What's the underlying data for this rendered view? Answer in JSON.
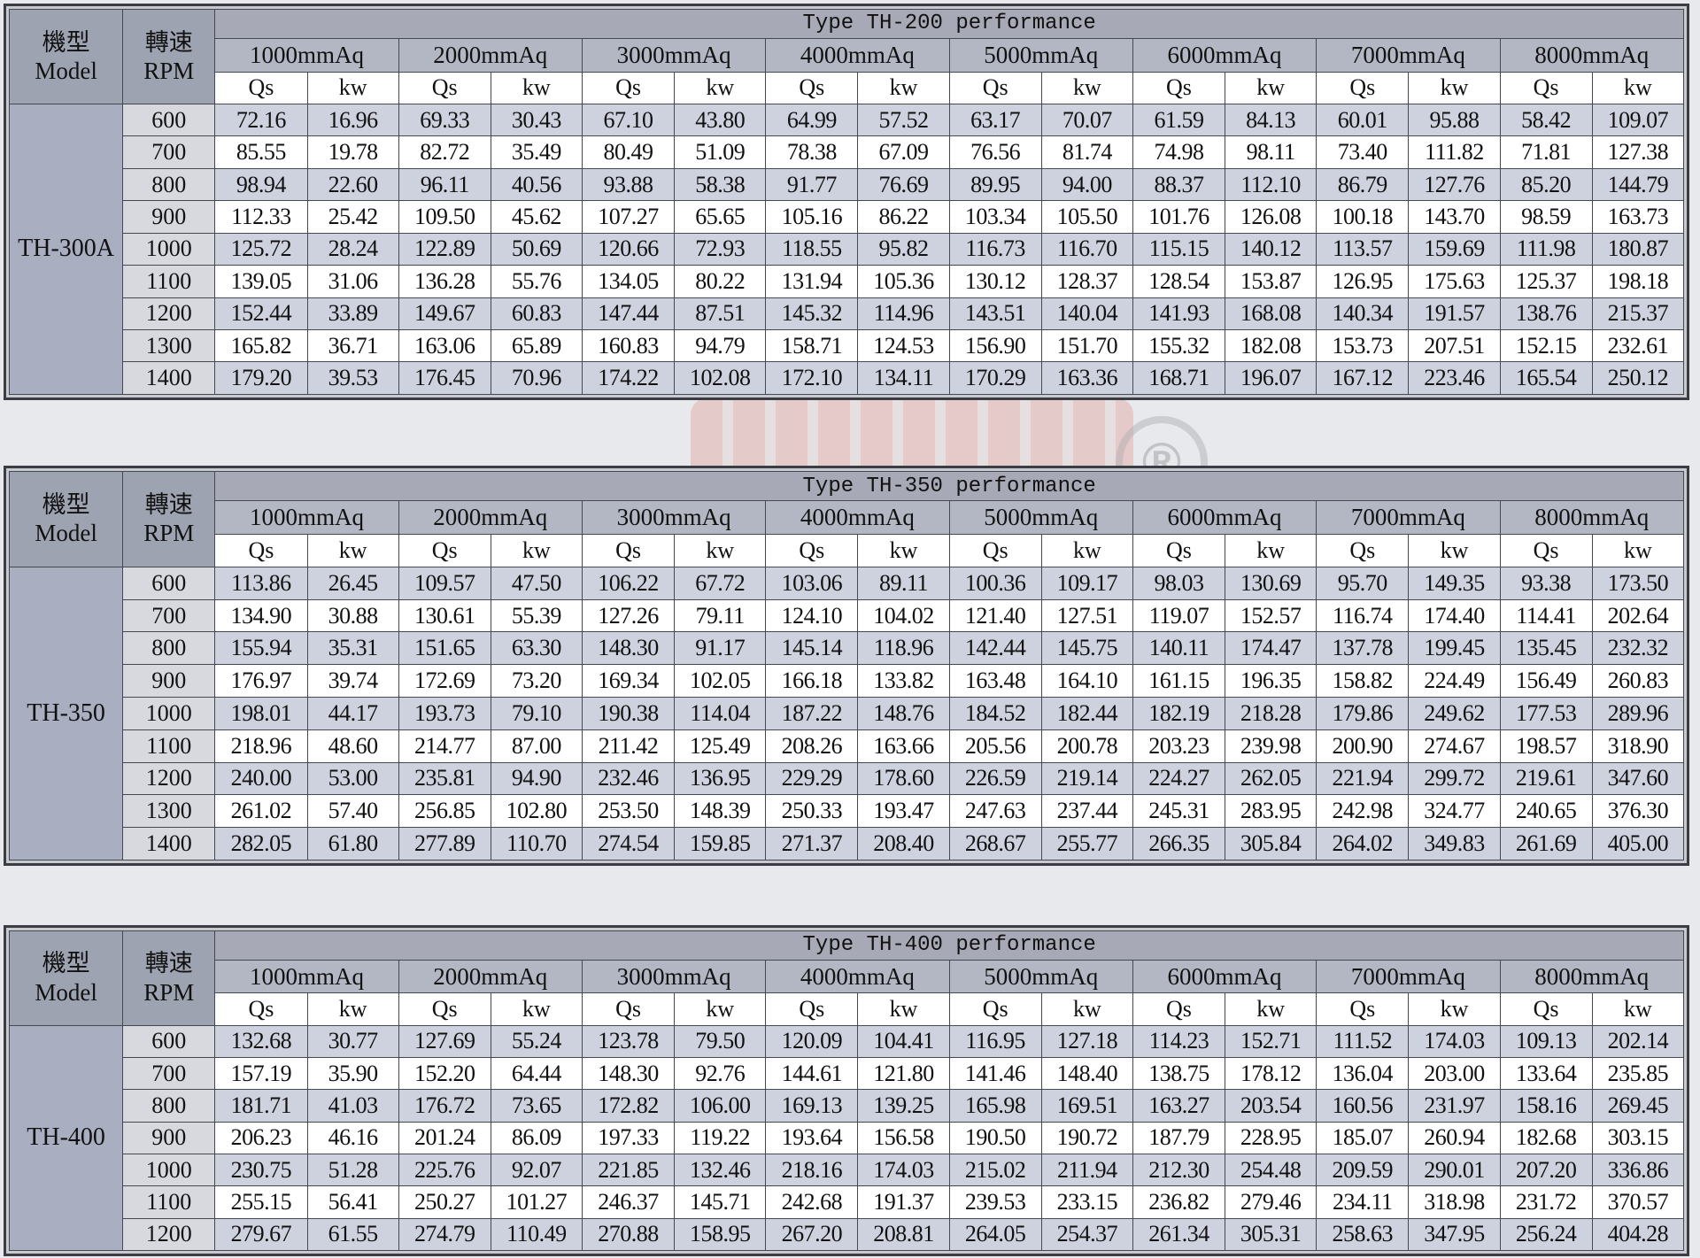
{
  "headers": {
    "model_cn": "機型",
    "model_en": "Model",
    "rpm_cn": "轉速",
    "rpm_en": "RPM",
    "qs": "Qs",
    "kw": "kw",
    "pressures": [
      "1000mmAq",
      "2000mmAq",
      "3000mmAq",
      "4000mmAq",
      "5000mmAq",
      "6000mmAq",
      "7000mmAq",
      "8000mmAq"
    ]
  },
  "watermark": {
    "registered": "®"
  },
  "colors": {
    "header": "#9ea3b2",
    "stripe": "#ced2de",
    "border": "#3a3d44"
  },
  "tables": [
    {
      "title": "Type TH-200 performance",
      "model": "TH-300A",
      "rows": [
        {
          "rpm": "600",
          "values": [
            "72.16",
            "16.96",
            "69.33",
            "30.43",
            "67.10",
            "43.80",
            "64.99",
            "57.52",
            "63.17",
            "70.07",
            "61.59",
            "84.13",
            "60.01",
            "95.88",
            "58.42",
            "109.07"
          ]
        },
        {
          "rpm": "700",
          "values": [
            "85.55",
            "19.78",
            "82.72",
            "35.49",
            "80.49",
            "51.09",
            "78.38",
            "67.09",
            "76.56",
            "81.74",
            "74.98",
            "98.11",
            "73.40",
            "111.82",
            "71.81",
            "127.38"
          ]
        },
        {
          "rpm": "800",
          "values": [
            "98.94",
            "22.60",
            "96.11",
            "40.56",
            "93.88",
            "58.38",
            "91.77",
            "76.69",
            "89.95",
            "94.00",
            "88.37",
            "112.10",
            "86.79",
            "127.76",
            "85.20",
            "144.79"
          ]
        },
        {
          "rpm": "900",
          "values": [
            "112.33",
            "25.42",
            "109.50",
            "45.62",
            "107.27",
            "65.65",
            "105.16",
            "86.22",
            "103.34",
            "105.50",
            "101.76",
            "126.08",
            "100.18",
            "143.70",
            "98.59",
            "163.73"
          ]
        },
        {
          "rpm": "1000",
          "values": [
            "125.72",
            "28.24",
            "122.89",
            "50.69",
            "120.66",
            "72.93",
            "118.55",
            "95.82",
            "116.73",
            "116.70",
            "115.15",
            "140.12",
            "113.57",
            "159.69",
            "111.98",
            "180.87"
          ]
        },
        {
          "rpm": "1100",
          "values": [
            "139.05",
            "31.06",
            "136.28",
            "55.76",
            "134.05",
            "80.22",
            "131.94",
            "105.36",
            "130.12",
            "128.37",
            "128.54",
            "153.87",
            "126.95",
            "175.63",
            "125.37",
            "198.18"
          ]
        },
        {
          "rpm": "1200",
          "values": [
            "152.44",
            "33.89",
            "149.67",
            "60.83",
            "147.44",
            "87.51",
            "145.32",
            "114.96",
            "143.51",
            "140.04",
            "141.93",
            "168.08",
            "140.34",
            "191.57",
            "138.76",
            "215.37"
          ]
        },
        {
          "rpm": "1300",
          "values": [
            "165.82",
            "36.71",
            "163.06",
            "65.89",
            "160.83",
            "94.79",
            "158.71",
            "124.53",
            "156.90",
            "151.70",
            "155.32",
            "182.08",
            "153.73",
            "207.51",
            "152.15",
            "232.61"
          ]
        },
        {
          "rpm": "1400",
          "values": [
            "179.20",
            "39.53",
            "176.45",
            "70.96",
            "174.22",
            "102.08",
            "172.10",
            "134.11",
            "170.29",
            "163.36",
            "168.71",
            "196.07",
            "167.12",
            "223.46",
            "165.54",
            "250.12"
          ]
        }
      ]
    },
    {
      "title": "Type TH-350 performance",
      "model": "TH-350",
      "rows": [
        {
          "rpm": "600",
          "values": [
            "113.86",
            "26.45",
            "109.57",
            "47.50",
            "106.22",
            "67.72",
            "103.06",
            "89.11",
            "100.36",
            "109.17",
            "98.03",
            "130.69",
            "95.70",
            "149.35",
            "93.38",
            "173.50"
          ]
        },
        {
          "rpm": "700",
          "values": [
            "134.90",
            "30.88",
            "130.61",
            "55.39",
            "127.26",
            "79.11",
            "124.10",
            "104.02",
            "121.40",
            "127.51",
            "119.07",
            "152.57",
            "116.74",
            "174.40",
            "114.41",
            "202.64"
          ]
        },
        {
          "rpm": "800",
          "values": [
            "155.94",
            "35.31",
            "151.65",
            "63.30",
            "148.30",
            "91.17",
            "145.14",
            "118.96",
            "142.44",
            "145.75",
            "140.11",
            "174.47",
            "137.78",
            "199.45",
            "135.45",
            "232.32"
          ]
        },
        {
          "rpm": "900",
          "values": [
            "176.97",
            "39.74",
            "172.69",
            "73.20",
            "169.34",
            "102.05",
            "166.18",
            "133.82",
            "163.48",
            "164.10",
            "161.15",
            "196.35",
            "158.82",
            "224.49",
            "156.49",
            "260.83"
          ]
        },
        {
          "rpm": "1000",
          "values": [
            "198.01",
            "44.17",
            "193.73",
            "79.10",
            "190.38",
            "114.04",
            "187.22",
            "148.76",
            "184.52",
            "182.44",
            "182.19",
            "218.28",
            "179.86",
            "249.62",
            "177.53",
            "289.96"
          ]
        },
        {
          "rpm": "1100",
          "values": [
            "218.96",
            "48.60",
            "214.77",
            "87.00",
            "211.42",
            "125.49",
            "208.26",
            "163.66",
            "205.56",
            "200.78",
            "203.23",
            "239.98",
            "200.90",
            "274.67",
            "198.57",
            "318.90"
          ]
        },
        {
          "rpm": "1200",
          "values": [
            "240.00",
            "53.00",
            "235.81",
            "94.90",
            "232.46",
            "136.95",
            "229.29",
            "178.60",
            "226.59",
            "219.14",
            "224.27",
            "262.05",
            "221.94",
            "299.72",
            "219.61",
            "347.60"
          ]
        },
        {
          "rpm": "1300",
          "values": [
            "261.02",
            "57.40",
            "256.85",
            "102.80",
            "253.50",
            "148.39",
            "250.33",
            "193.47",
            "247.63",
            "237.44",
            "245.31",
            "283.95",
            "242.98",
            "324.77",
            "240.65",
            "376.30"
          ]
        },
        {
          "rpm": "1400",
          "values": [
            "282.05",
            "61.80",
            "277.89",
            "110.70",
            "274.54",
            "159.85",
            "271.37",
            "208.40",
            "268.67",
            "255.77",
            "266.35",
            "305.84",
            "264.02",
            "349.83",
            "261.69",
            "405.00"
          ]
        }
      ]
    },
    {
      "title": "Type TH-400 performance",
      "model": "TH-400",
      "rows": [
        {
          "rpm": "600",
          "values": [
            "132.68",
            "30.77",
            "127.69",
            "55.24",
            "123.78",
            "79.50",
            "120.09",
            "104.41",
            "116.95",
            "127.18",
            "114.23",
            "152.71",
            "111.52",
            "174.03",
            "109.13",
            "202.14"
          ]
        },
        {
          "rpm": "700",
          "values": [
            "157.19",
            "35.90",
            "152.20",
            "64.44",
            "148.30",
            "92.76",
            "144.61",
            "121.80",
            "141.46",
            "148.40",
            "138.75",
            "178.12",
            "136.04",
            "203.00",
            "133.64",
            "235.85"
          ]
        },
        {
          "rpm": "800",
          "values": [
            "181.71",
            "41.03",
            "176.72",
            "73.65",
            "172.82",
            "106.00",
            "169.13",
            "139.25",
            "165.98",
            "169.51",
            "163.27",
            "203.54",
            "160.56",
            "231.97",
            "158.16",
            "269.45"
          ]
        },
        {
          "rpm": "900",
          "values": [
            "206.23",
            "46.16",
            "201.24",
            "86.09",
            "197.33",
            "119.22",
            "193.64",
            "156.58",
            "190.50",
            "190.72",
            "187.79",
            "228.95",
            "185.07",
            "260.94",
            "182.68",
            "303.15"
          ]
        },
        {
          "rpm": "1000",
          "values": [
            "230.75",
            "51.28",
            "225.76",
            "92.07",
            "221.85",
            "132.46",
            "218.16",
            "174.03",
            "215.02",
            "211.94",
            "212.30",
            "254.48",
            "209.59",
            "290.01",
            "207.20",
            "336.86"
          ]
        },
        {
          "rpm": "1100",
          "values": [
            "255.15",
            "56.41",
            "250.27",
            "101.27",
            "246.37",
            "145.71",
            "242.68",
            "191.37",
            "239.53",
            "233.15",
            "236.82",
            "279.46",
            "234.11",
            "318.98",
            "231.72",
            "370.57"
          ]
        },
        {
          "rpm": "1200",
          "values": [
            "279.67",
            "61.55",
            "274.79",
            "110.49",
            "270.88",
            "158.95",
            "267.20",
            "208.81",
            "264.05",
            "254.37",
            "261.34",
            "305.31",
            "258.63",
            "347.95",
            "256.24",
            "404.28"
          ]
        }
      ]
    }
  ]
}
